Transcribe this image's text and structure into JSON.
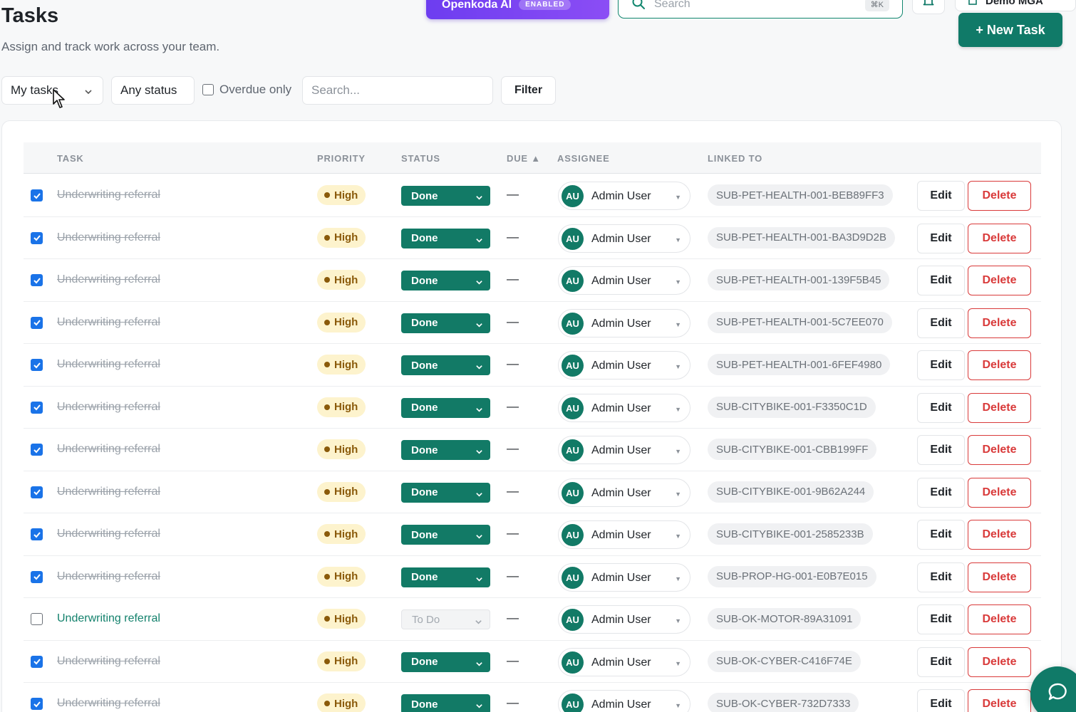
{
  "header": {
    "title": "Tasks",
    "subtitle": "Assign and track work across your team.",
    "ai_button_label": "Openkoda AI",
    "ai_badge": "ENABLED",
    "search_placeholder": "Search",
    "search_shortcut": "⌘K",
    "org_name": "Demo MGA",
    "new_task_label": "+ New Task"
  },
  "filters": {
    "scope_value": "My tasks",
    "status_value": "Any status",
    "overdue_label": "Overdue only",
    "overdue_checked": false,
    "search_placeholder": "Search...",
    "filter_button": "Filter"
  },
  "table": {
    "columns": [
      "TASK",
      "PRIORITY",
      "STATUS",
      "DUE ▲",
      "ASSIGNEE",
      "LINKED TO"
    ],
    "rows": [
      {
        "checked": true,
        "task": "Underwriting referral",
        "priority": "High",
        "status": "Done",
        "due": "—",
        "assignee_initials": "AU",
        "assignee": "Admin User",
        "linked_to": "SUB-PET-HEALTH-001-BEB89FF3",
        "edit": "Edit",
        "delete": "Delete"
      },
      {
        "checked": true,
        "task": "Underwriting referral",
        "priority": "High",
        "status": "Done",
        "due": "—",
        "assignee_initials": "AU",
        "assignee": "Admin User",
        "linked_to": "SUB-PET-HEALTH-001-BA3D9D2B",
        "edit": "Edit",
        "delete": "Delete"
      },
      {
        "checked": true,
        "task": "Underwriting referral",
        "priority": "High",
        "status": "Done",
        "due": "—",
        "assignee_initials": "AU",
        "assignee": "Admin User",
        "linked_to": "SUB-PET-HEALTH-001-139F5B45",
        "edit": "Edit",
        "delete": "Delete"
      },
      {
        "checked": true,
        "task": "Underwriting referral",
        "priority": "High",
        "status": "Done",
        "due": "—",
        "assignee_initials": "AU",
        "assignee": "Admin User",
        "linked_to": "SUB-PET-HEALTH-001-5C7EE070",
        "edit": "Edit",
        "delete": "Delete"
      },
      {
        "checked": true,
        "task": "Underwriting referral",
        "priority": "High",
        "status": "Done",
        "due": "—",
        "assignee_initials": "AU",
        "assignee": "Admin User",
        "linked_to": "SUB-PET-HEALTH-001-6FEF4980",
        "edit": "Edit",
        "delete": "Delete"
      },
      {
        "checked": true,
        "task": "Underwriting referral",
        "priority": "High",
        "status": "Done",
        "due": "—",
        "assignee_initials": "AU",
        "assignee": "Admin User",
        "linked_to": "SUB-CITYBIKE-001-F3350C1D",
        "edit": "Edit",
        "delete": "Delete"
      },
      {
        "checked": true,
        "task": "Underwriting referral",
        "priority": "High",
        "status": "Done",
        "due": "—",
        "assignee_initials": "AU",
        "assignee": "Admin User",
        "linked_to": "SUB-CITYBIKE-001-CBB199FF",
        "edit": "Edit",
        "delete": "Delete"
      },
      {
        "checked": true,
        "task": "Underwriting referral",
        "priority": "High",
        "status": "Done",
        "due": "—",
        "assignee_initials": "AU",
        "assignee": "Admin User",
        "linked_to": "SUB-CITYBIKE-001-9B62A244",
        "edit": "Edit",
        "delete": "Delete"
      },
      {
        "checked": true,
        "task": "Underwriting referral",
        "priority": "High",
        "status": "Done",
        "due": "—",
        "assignee_initials": "AU",
        "assignee": "Admin User",
        "linked_to": "SUB-CITYBIKE-001-2585233B",
        "edit": "Edit",
        "delete": "Delete"
      },
      {
        "checked": true,
        "task": "Underwriting referral",
        "priority": "High",
        "status": "Done",
        "due": "—",
        "assignee_initials": "AU",
        "assignee": "Admin User",
        "linked_to": "SUB-PROP-HG-001-E0B7E015",
        "edit": "Edit",
        "delete": "Delete"
      },
      {
        "checked": false,
        "task": "Underwriting referral",
        "priority": "High",
        "status": "To Do",
        "due": "—",
        "assignee_initials": "AU",
        "assignee": "Admin User",
        "linked_to": "SUB-OK-MOTOR-89A31091",
        "edit": "Edit",
        "delete": "Delete"
      },
      {
        "checked": true,
        "task": "Underwriting referral",
        "priority": "High",
        "status": "Done",
        "due": "—",
        "assignee_initials": "AU",
        "assignee": "Admin User",
        "linked_to": "SUB-OK-CYBER-C416F74E",
        "edit": "Edit",
        "delete": "Delete"
      },
      {
        "checked": true,
        "task": "Underwriting referral",
        "priority": "High",
        "status": "Done",
        "due": "—",
        "assignee_initials": "AU",
        "assignee": "Admin User",
        "linked_to": "SUB-OK-CYBER-732D7333",
        "edit": "Edit",
        "delete": "Delete"
      }
    ]
  },
  "colors": {
    "brand_teal": "#107a68",
    "ai_purple": "#7a45f2",
    "priority_bg": "#fdf3cd",
    "delete_red": "#d93a3a",
    "checkbox_blue": "#1a73e8"
  },
  "icons": {
    "search": "search-icon",
    "bell": "bell-icon",
    "org": "building-icon",
    "chevron": "chevron-down-icon",
    "chat": "chat-icon",
    "cursor": "mouse-cursor-icon"
  }
}
